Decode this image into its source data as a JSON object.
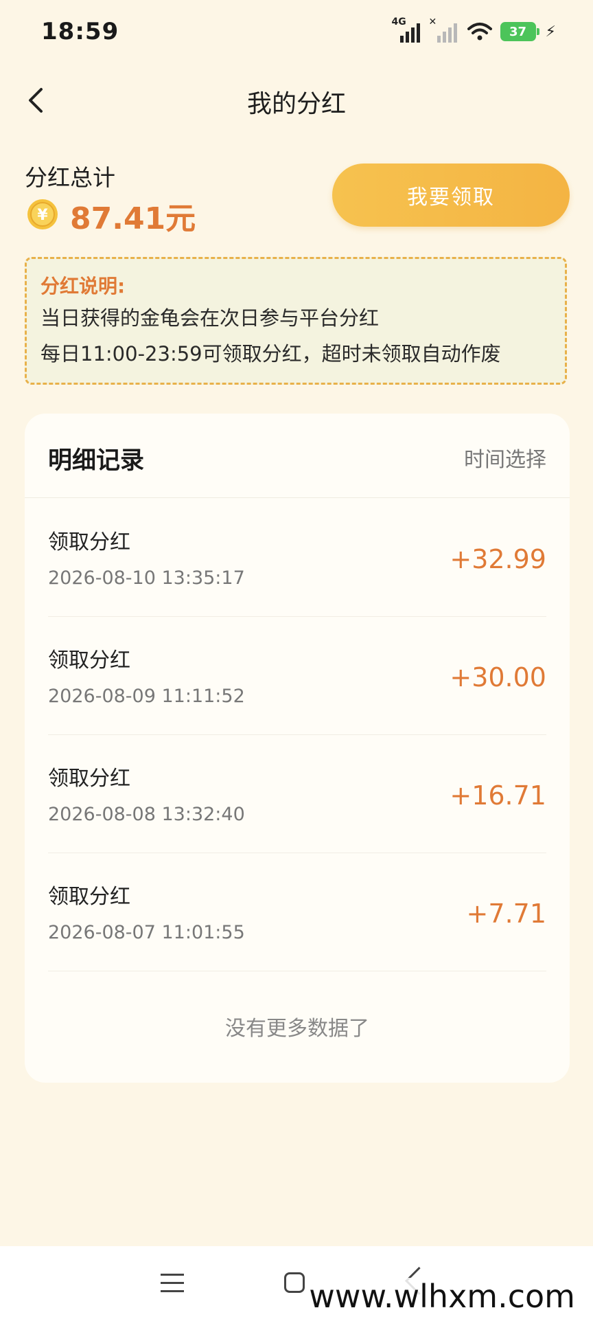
{
  "status_bar": {
    "time": "18:59",
    "network_tag": "4G",
    "battery": "37"
  },
  "header": {
    "title": "我的分红"
  },
  "summary": {
    "label": "分红总计",
    "amount": "87.41元",
    "claim_button": "我要领取"
  },
  "notice": {
    "title": "分红说明:",
    "lines": [
      "当日获得的金龟会在次日参与平台分红",
      "每日11:00-23:59可领取分红，超时未领取自动作废"
    ]
  },
  "records": {
    "title": "明细记录",
    "time_select": "时间选择",
    "items": [
      {
        "title": "领取分红",
        "time": "2026-08-10 13:35:17",
        "amount": "+32.99"
      },
      {
        "title": "领取分红",
        "time": "2026-08-09 11:11:52",
        "amount": "+30.00"
      },
      {
        "title": "领取分红",
        "time": "2026-08-08 13:32:40",
        "amount": "+16.71"
      },
      {
        "title": "领取分红",
        "time": "2026-08-07 11:01:55",
        "amount": "+7.71"
      }
    ],
    "no_more": "没有更多数据了"
  },
  "watermark": "www.wlhxm.com",
  "colors": {
    "background": "#FDF6E6",
    "accent": "#E07A36",
    "button": "#F6C24F",
    "notice_border": "#E8B14A"
  }
}
